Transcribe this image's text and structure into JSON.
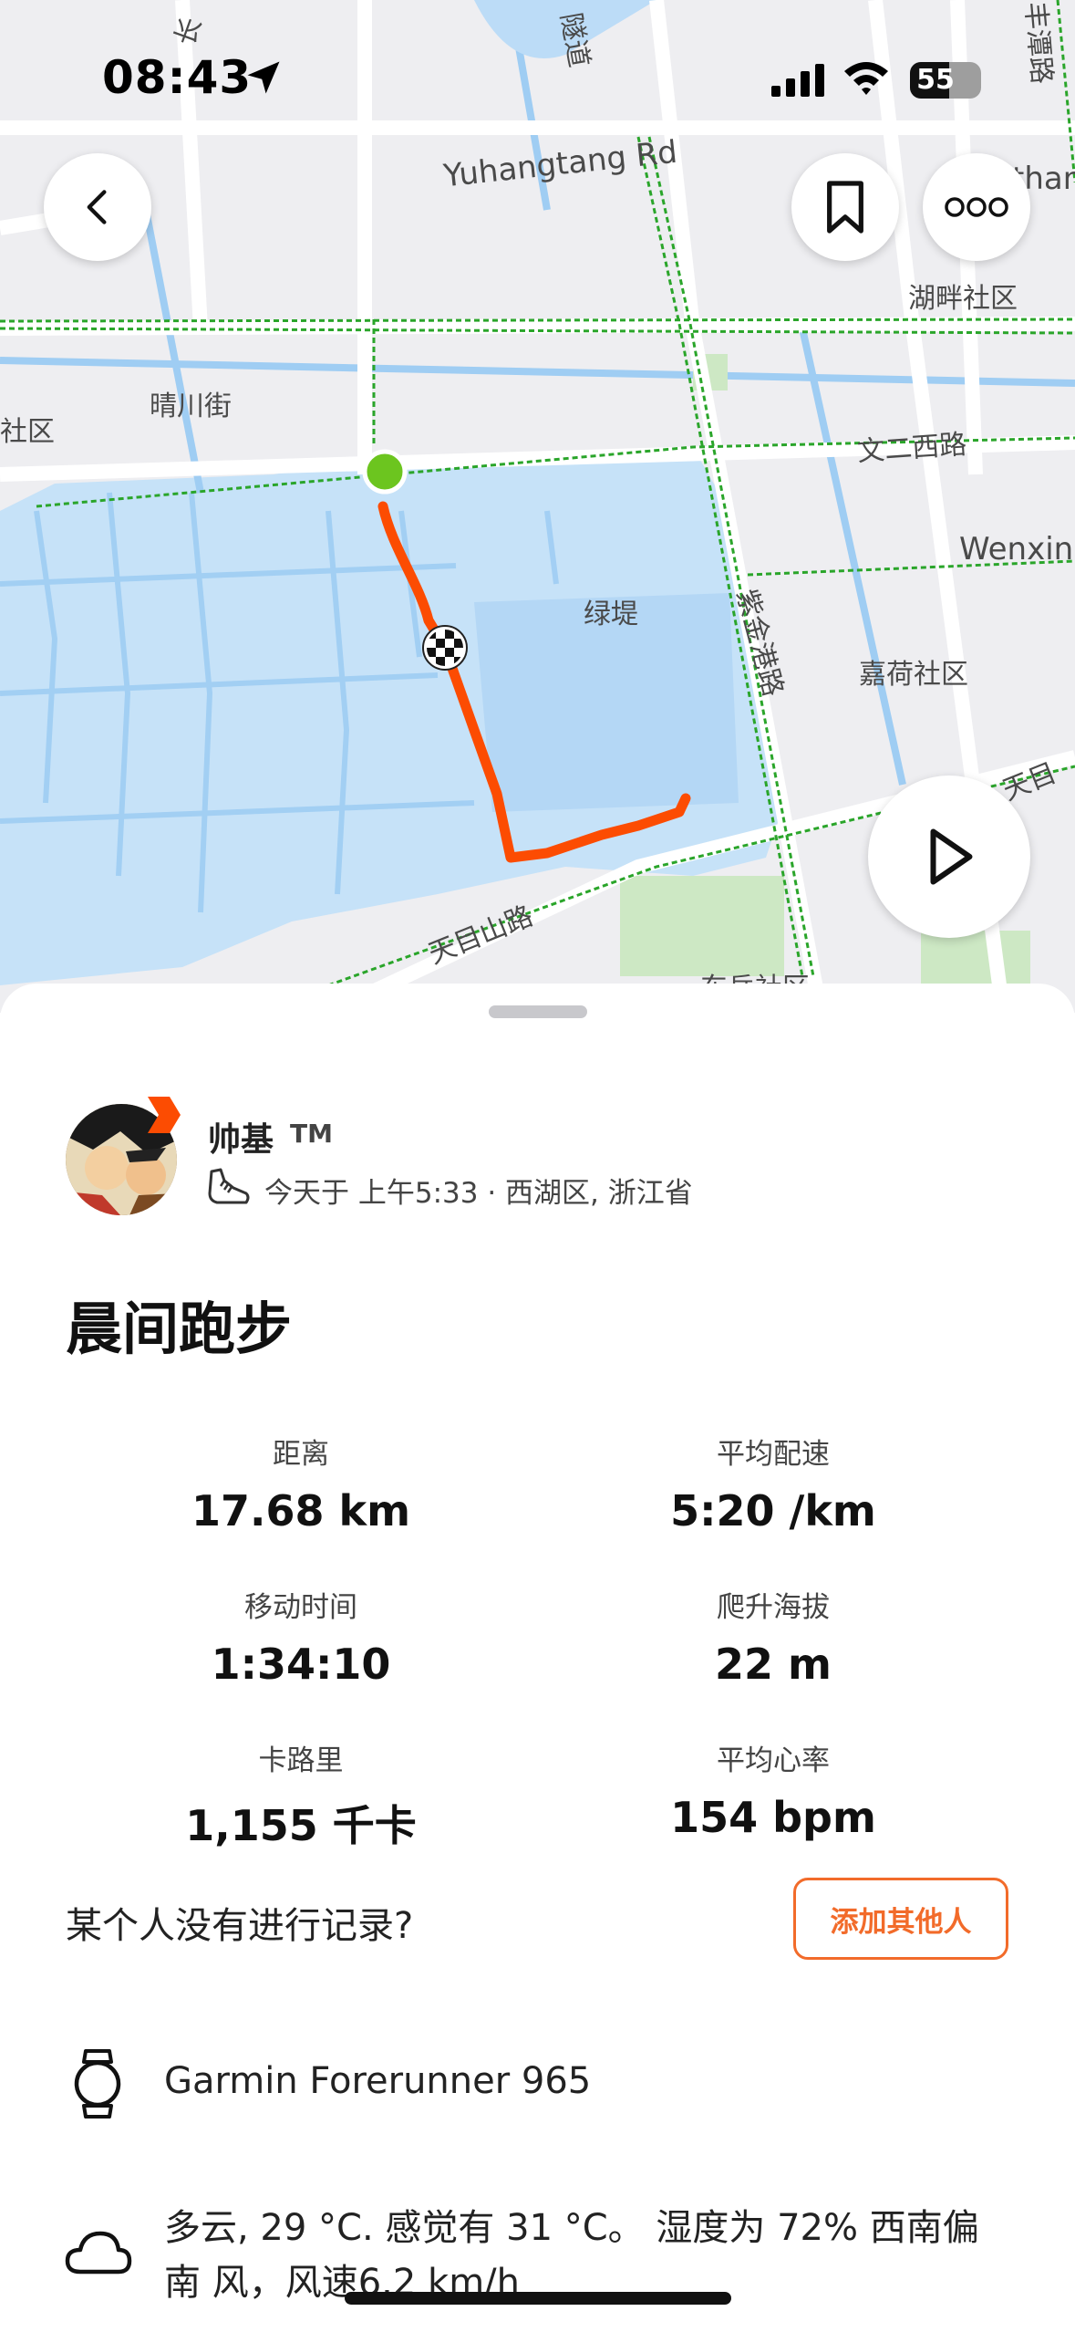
{
  "status_bar": {
    "time": "08:43",
    "battery_level": "55",
    "battery_fraction": 0.55
  },
  "map": {
    "labels": {
      "yuhangtang_rd": "Yuhangtang Rd",
      "wenxin": "Wenxin",
      "lake_community": "湖畔社区",
      "qingchuan_st": "晴川街",
      "community_left": "社区",
      "wener_west_rd": "文二西路",
      "green_dike": "绿堤",
      "zijingang_rd": "紫金港路",
      "jiahe_community": "嘉荷社区",
      "tianmushan_rd": "天目山路",
      "tianmushan_rd_right": "天目",
      "dongyue_community": "东岳社区",
      "tunnel": "隧道",
      "top_left_road": "长",
      "top_right_road": "丰潭路",
      "top_right_road2": "than"
    },
    "route_color": "#fc4c02",
    "start_color": "#6cc51f"
  },
  "activity": {
    "athlete_name": "帅基",
    "athlete_tag": "TM",
    "meta": "今天于 上午5:33 · 西湖区, 浙江省",
    "title": "晨间跑步"
  },
  "stats": [
    {
      "label": "距离",
      "value": "17.68 km"
    },
    {
      "label": "平均配速",
      "value": "5:20 /km"
    },
    {
      "label": "移动时间",
      "value": "1:34:10"
    },
    {
      "label": "爬升海拔",
      "value": "22 m"
    },
    {
      "label": "卡路里",
      "value": "1,155 千卡"
    },
    {
      "label": "平均心率",
      "value": "154 bpm"
    }
  ],
  "no_record_prompt": "某个人没有进行记录?",
  "add_others_label": "添加其他人",
  "device": "Garmin Forerunner 965",
  "weather": "多云, 29 °C. 感觉有 31 °C。 湿度为 72% 西南偏南 风，风速6.2 km/h",
  "colors": {
    "accent": "#fc4c02",
    "button_orange": "#f26b2a",
    "water": "#bcdcf7"
  }
}
